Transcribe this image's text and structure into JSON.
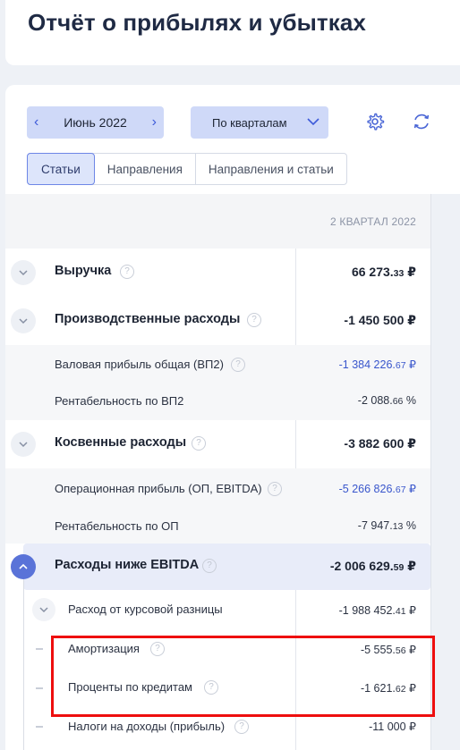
{
  "page": {
    "title": "Отчёт о прибылях и убытках"
  },
  "toolbar": {
    "period_label": "Июнь 2022",
    "grouping_label": "По кварталам",
    "tabs": [
      "Статьи",
      "Направления",
      "Направления и статьи"
    ],
    "active_tab": "Статьи"
  },
  "table": {
    "column_header": "2 КВАРТАЛ 2022",
    "rows": [
      {
        "label": "Выручка",
        "value_main": "66 273.",
        "value_dec": "33",
        "value_cur": " ₽"
      },
      {
        "label": "Производственные расходы",
        "value_main": "-1 450 500",
        "value_dec": "",
        "value_cur": " ₽"
      },
      {
        "label": "Валовая прибыль общая (ВП2)",
        "value_main": "-1 384 226.",
        "value_dec": "67",
        "value_cur": " ₽"
      },
      {
        "label": "Рентабельность по ВП2",
        "value_main": "-2 088.",
        "value_dec": "66",
        "value_cur": " %"
      },
      {
        "label": "Косвенные расходы",
        "value_main": "-3 882 600",
        "value_dec": "",
        "value_cur": " ₽"
      },
      {
        "label": "Операционная прибыль (ОП, EBITDA)",
        "value_main": "-5 266 826.",
        "value_dec": "67",
        "value_cur": " ₽"
      },
      {
        "label": "Рентабельность по ОП",
        "value_main": "-7 947.",
        "value_dec": "13",
        "value_cur": " %"
      },
      {
        "label": "Расходы ниже EBITDA",
        "value_main": "-2 006 629.",
        "value_dec": "59",
        "value_cur": " ₽"
      },
      {
        "label": "Расход от курсовой разницы",
        "value_main": "-1 988 452.",
        "value_dec": "41",
        "value_cur": " ₽"
      },
      {
        "label": "Амортизация",
        "value_main": "-5 555.",
        "value_dec": "56",
        "value_cur": " ₽"
      },
      {
        "label": "Проценты по кредитам",
        "value_main": "-1 621.",
        "value_dec": "62",
        "value_cur": " ₽"
      },
      {
        "label": "Налоги на доходы (прибыль)",
        "value_main": "-11 000",
        "value_dec": "",
        "value_cur": " ₽"
      }
    ]
  },
  "colors": {
    "accent": "#5a73d8",
    "link_value": "#3956cc",
    "highlight_box": "#ee0e0e"
  },
  "icons": {
    "settings": "gear-icon",
    "refresh": "refresh-icon"
  }
}
